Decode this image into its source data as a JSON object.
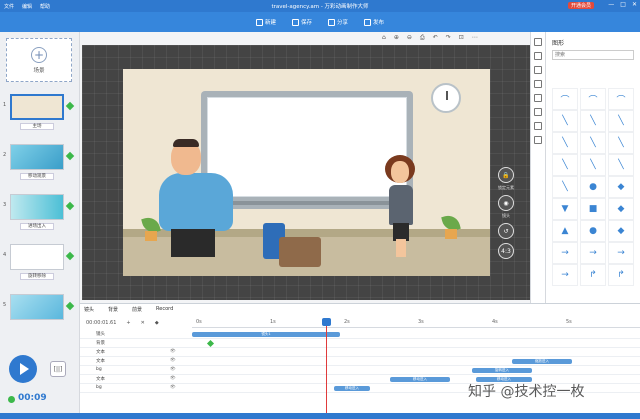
{
  "titlebar": {
    "menu": [
      "文件",
      "编辑",
      "帮助"
    ],
    "title": "travel-agency.am - 万彩动画制作大师",
    "vip_label": "开通会员",
    "win_controls": [
      "—",
      "□",
      "✕"
    ]
  },
  "toolbar": {
    "items": [
      {
        "icon": "new-icon",
        "label": "新建"
      },
      {
        "icon": "save-icon",
        "label": "保存"
      },
      {
        "icon": "share-icon",
        "label": "分享"
      },
      {
        "icon": "publish-icon",
        "label": "发布"
      }
    ]
  },
  "left": {
    "add_scene_label": "场景",
    "scenes": [
      {
        "num": "1",
        "name": "主场"
      },
      {
        "num": "2",
        "name": "移动观景"
      },
      {
        "num": "3",
        "name": "进场出入"
      },
      {
        "num": "4",
        "name": "旋转移除"
      },
      {
        "num": "5",
        "name": ""
      }
    ]
  },
  "stage": {
    "buttons": [
      {
        "icon": "lock-icon",
        "label": "锁定元素"
      },
      {
        "icon": "record-icon",
        "label": "镜头"
      },
      {
        "icon": "reset-icon",
        "label": ""
      },
      {
        "icon": "ratio-icon",
        "label": "4:3"
      }
    ],
    "view_tools": [
      "⌂",
      "⊕",
      "⊖",
      "⎙",
      "↶",
      "↷",
      "⊡",
      "⋯"
    ]
  },
  "shape_panel": {
    "title": "图形",
    "search_placeholder": "搜索",
    "shapes": [
      "⌒",
      "⌒",
      "⌒",
      "╲",
      "╲",
      "╲",
      "╲",
      "╲",
      "╲",
      "╲",
      "╲",
      "╲",
      "╲",
      "●",
      "◆",
      "▼",
      "■",
      "◆",
      "▲",
      "●",
      "◆",
      "→",
      "→",
      "→",
      "→",
      "↱",
      "↱"
    ]
  },
  "timeline": {
    "tabs": [
      "镜头",
      "背景",
      "前景",
      "Record"
    ],
    "time_readout_small": "00:00:01.61",
    "ruler": [
      "0s",
      "1s",
      "2s",
      "3s",
      "4s",
      "5s"
    ],
    "rows": [
      {
        "label": "镜头",
        "toggle": ""
      },
      {
        "label": "背景",
        "toggle": ""
      },
      {
        "label": "文本",
        "toggle": "👁"
      },
      {
        "label": "文本",
        "toggle": "👁"
      },
      {
        "label": "bg",
        "toggle": "👁"
      },
      {
        "label": "文本",
        "toggle": "👁"
      },
      {
        "label": "bg",
        "toggle": "👁"
      }
    ],
    "bar_labels": [
      "镜头1",
      "缩放进入",
      "旋转进入",
      "移动进入",
      "移动进入",
      "移动进入"
    ]
  },
  "playback": {
    "time": "00:09",
    "step_label": "[||]"
  },
  "watermark": "知乎 @技术控一枚"
}
